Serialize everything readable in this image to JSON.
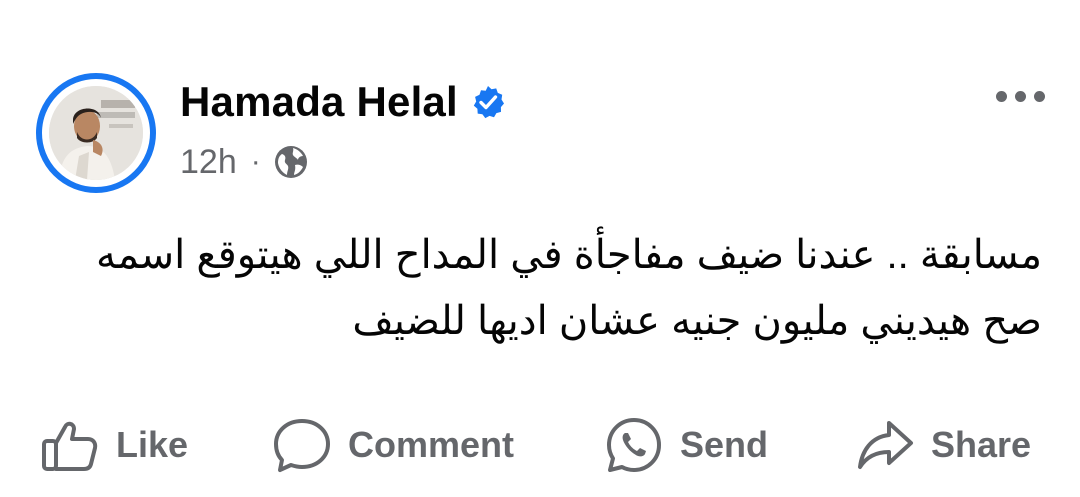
{
  "author": {
    "name": "Hamada Helal",
    "verified": true
  },
  "meta": {
    "time": "12h",
    "separator": "·",
    "audience_icon": "globe-icon"
  },
  "post": {
    "lines": [
      "مسابقة .. عندنا ضيف مفاجأة في المداح اللي هيتوقع اسمه",
      "صح هيديني مليون جنيه عشان اديها للضيف"
    ]
  },
  "actions": {
    "like": "Like",
    "comment": "Comment",
    "send": "Send",
    "share": "Share"
  },
  "colors": {
    "accent": "#1877f2",
    "text": "#050505",
    "secondary": "#65676b"
  }
}
